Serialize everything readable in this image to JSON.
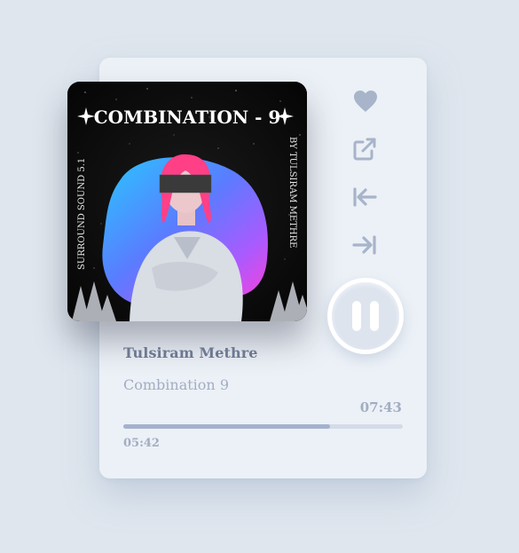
{
  "player": {
    "artist": "Tulsiram Methre",
    "track": "Combination 9",
    "duration": "07:43",
    "elapsed": "05:42",
    "progress": 0.74,
    "state": "playing"
  },
  "cover": {
    "title": "COMBINATION - 9",
    "left_text": "SURROUND SOUND 5.1",
    "right_text": "BY  TULSIRAM METHRE"
  },
  "controls": {
    "like_icon": "heart-icon",
    "share_icon": "external-link-icon",
    "prev_icon": "skip-back-icon",
    "next_icon": "skip-forward-icon",
    "pause_icon": "pause-icon"
  },
  "colors": {
    "background": "#dfe6ee",
    "card": "#ecf1f7",
    "icon": "#a7b4c9",
    "artist_text": "#6d7891",
    "muted_text": "#a3adc2",
    "progress_fill": "#a4b2cc",
    "progress_track": "#d3dbe7"
  }
}
